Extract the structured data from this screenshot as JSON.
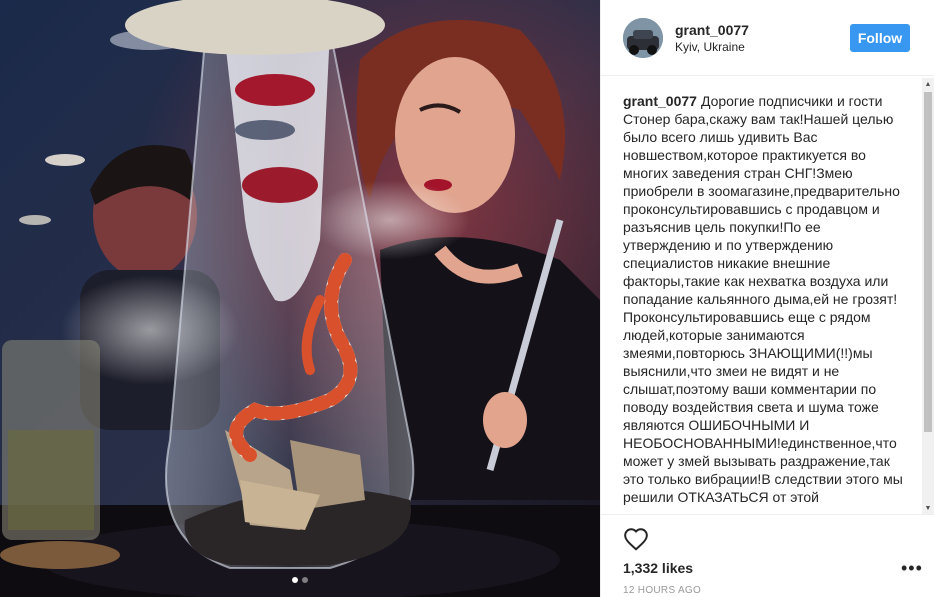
{
  "post": {
    "username": "grant_0077",
    "location": "Kyiv, Ukraine",
    "follow_label": "Follow",
    "caption_user": "grant_0077",
    "caption_text": "Дорогие подписчики и гости Стонер бара,скажу вам так!Нашей целью было всего лишь удивить Вас новшеством,которое практикуется во многих заведения стран СНГ!Змею приобрели в зоомагазине,предварительно проконсультировавшись с продавцом и разъяснив цель покупки!По ее утверждению и по утверждению специалистов никакие внешние факторы,такие как нехватка воздуха или попадание кальянного дыма,ей не грозят!Проконсультировавшись еще с рядом людей,которые занимаются змеями,повторюсь ЗНАЮЩИМИ(!!)мы выяснили,что змеи не видят и не слышат,поэтому ваши комментарии по поводу воздействия света и шума тоже являются ОШИБОЧНЫМИ И НЕОБОСНОВАННЫМИ!единственное,что может у змей вызывать раздражение,так это только вибрации!В следствии этого мы решили ОТКАЗАТЬСЯ от этой",
    "likes": "1,332 likes",
    "timestamp": "12 HOURS AGO",
    "more_label": "•••",
    "carousel": {
      "total": 2,
      "active": 1
    },
    "icons": {
      "heart": "heart-icon",
      "more": "more-options-icon",
      "avatar": "avatar"
    },
    "colors": {
      "follow_button": "#3897f0",
      "muted_text": "#999999",
      "text": "#262626"
    }
  }
}
